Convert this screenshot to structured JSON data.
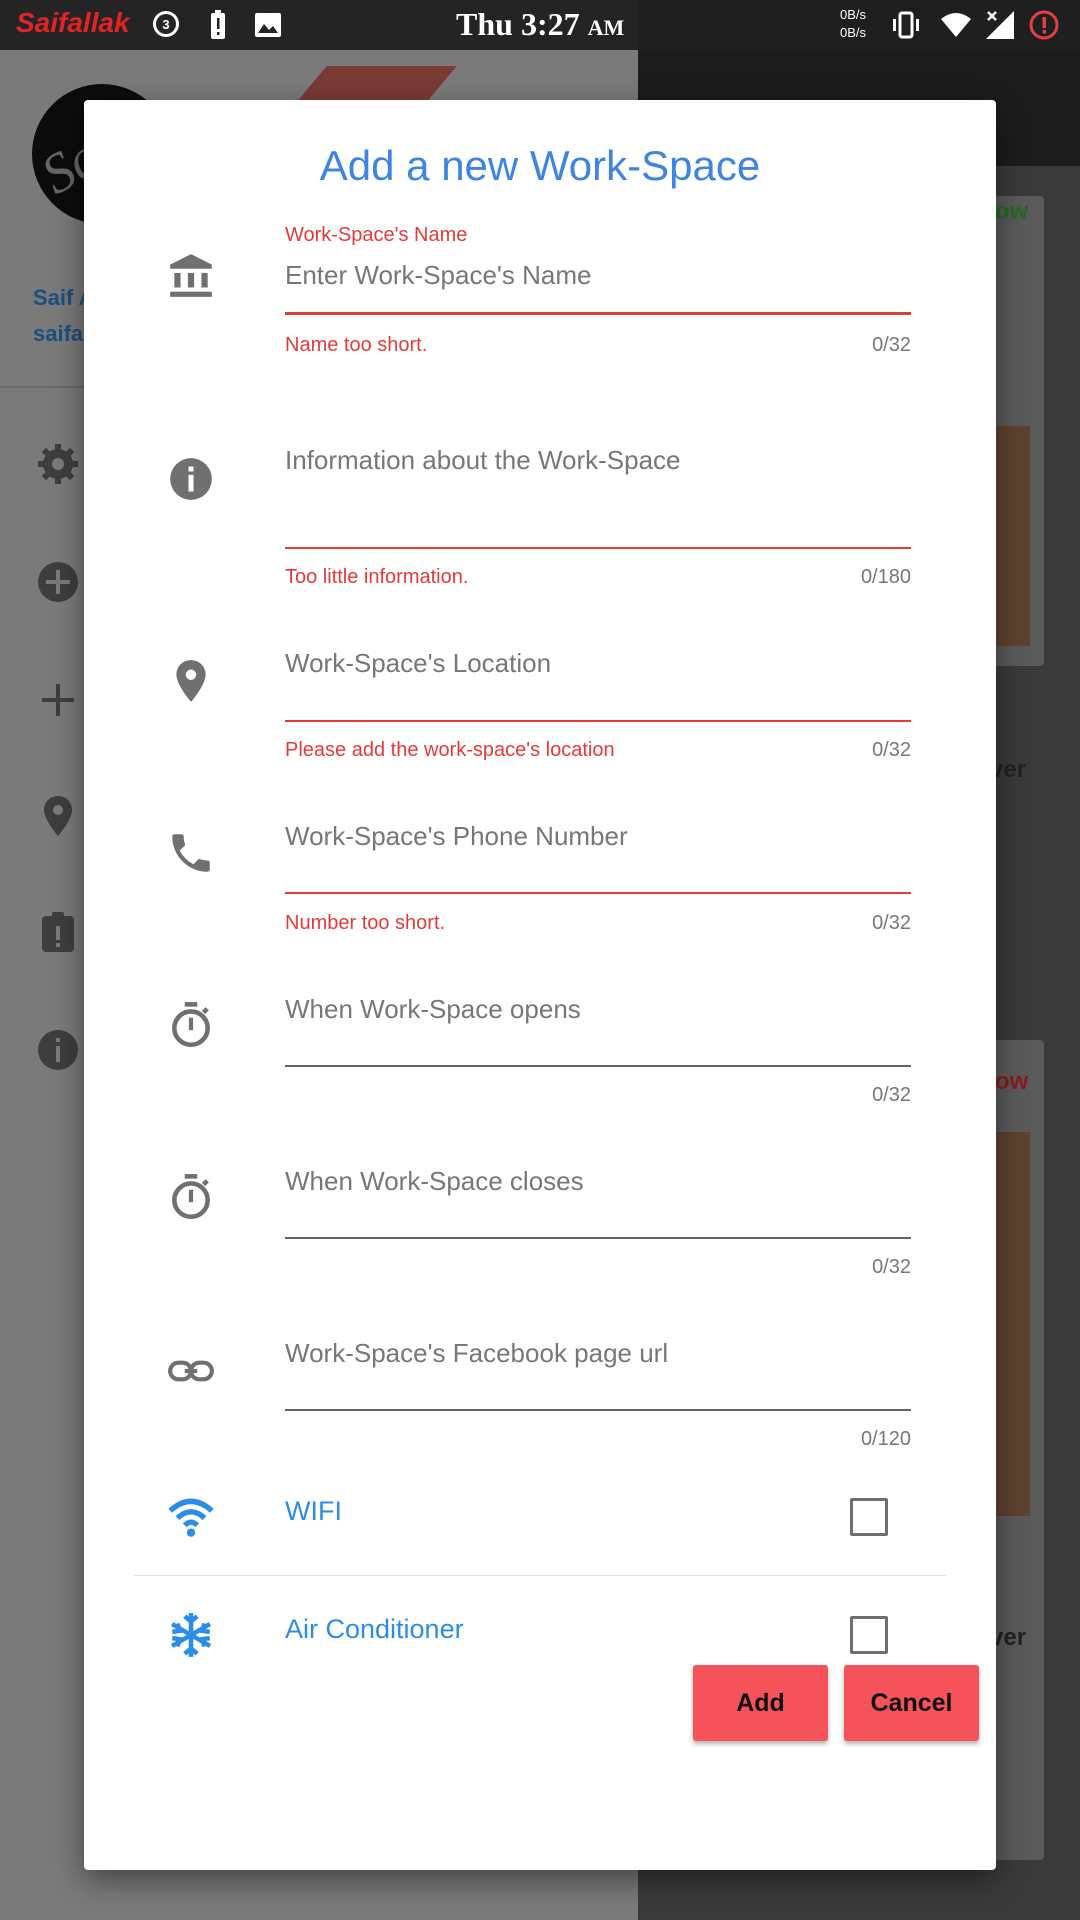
{
  "status_bar": {
    "brand": "Saifallak",
    "notification_count": "3",
    "time": "Thu 3:27",
    "ampm": "AM",
    "net_up": "0B/s",
    "net_down": "0B/s",
    "icons": [
      "chat-bubble-icon",
      "battery-alert-icon",
      "image-icon",
      "vibrate-icon",
      "wifi-icon",
      "signal-icon",
      "alert-circle-icon"
    ]
  },
  "background": {
    "user_name": "Saif A",
    "user_email": "saifa",
    "card_top_text": "ow",
    "card_mid_text": "ver",
    "card_bottom_text": "ow",
    "card_bottom_text2": "ver",
    "drawer_icons": [
      "gear-icon",
      "add-circle-icon",
      "plus-icon",
      "location-pin-icon",
      "clipboard-alert-icon",
      "info-icon"
    ]
  },
  "dialog": {
    "title": "Add a new Work-Space",
    "fields": {
      "name": {
        "label": "Work-Space's Name",
        "placeholder": "Enter Work-Space's Name",
        "error": "Name too short.",
        "counter": "0/32",
        "icon": "bank-icon"
      },
      "info": {
        "placeholder": "Information about the Work-Space",
        "error": "Too little information.",
        "counter": "0/180",
        "icon": "info-icon"
      },
      "location": {
        "placeholder": "Work-Space's Location",
        "error": "Please add the work-space's location",
        "counter": "0/32",
        "icon": "location-pin-icon"
      },
      "phone": {
        "placeholder": "Work-Space's Phone Number",
        "error": "Number too short.",
        "counter": "0/32",
        "icon": "phone-icon"
      },
      "opens": {
        "placeholder": "When Work-Space opens",
        "counter": "0/32",
        "icon": "timer-icon"
      },
      "closes": {
        "placeholder": "When Work-Space closes",
        "counter": "0/32",
        "icon": "timer-icon"
      },
      "facebook": {
        "placeholder": "Work-Space's Facebook page url",
        "counter": "0/120",
        "icon": "link-icon"
      }
    },
    "checkboxes": {
      "wifi": {
        "label": "WIFI",
        "checked": false,
        "icon": "wifi-icon"
      },
      "ac": {
        "label": "Air Conditioner",
        "checked": false,
        "icon": "snowflake-icon"
      }
    },
    "buttons": {
      "add": "Add",
      "cancel": "Cancel"
    },
    "colors": {
      "title": "#3d84e3",
      "error": "#e53a3a",
      "accent": "#2b8de6",
      "button": "#f5525a"
    }
  }
}
